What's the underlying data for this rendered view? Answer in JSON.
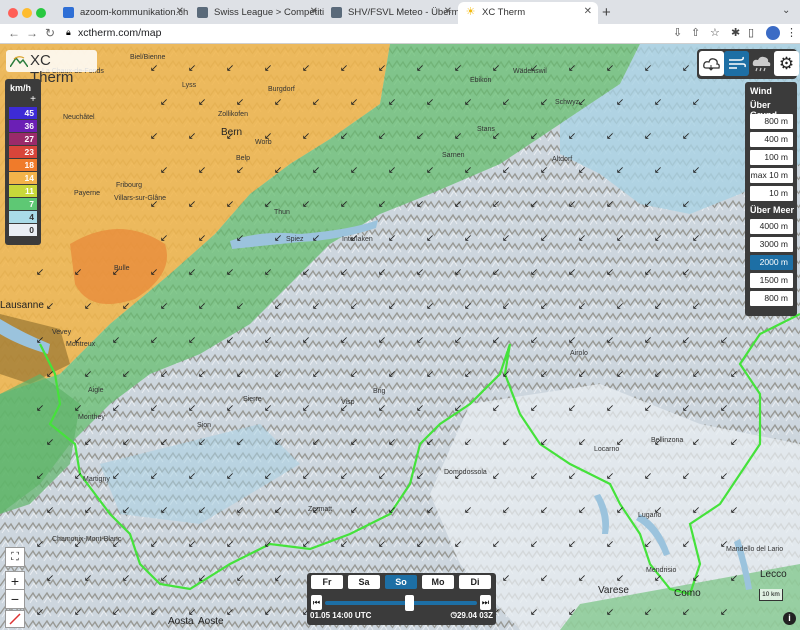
{
  "browser": {
    "tabs": [
      {
        "label": "azoom-kommunikation.ch – Ka",
        "fav_color": "#2f6fd6"
      },
      {
        "label": "Swiss League > Competition N",
        "fav_color": "#5a6a7a"
      },
      {
        "label": "SHV/FSVL Meteo - Übermorge",
        "fav_color": "#5a6a7a"
      },
      {
        "label": "XC Therm",
        "fav_color": "#f2b90f"
      }
    ],
    "url": "xctherm.com/map"
  },
  "app": {
    "logo_text": "XC Therm"
  },
  "legend": {
    "unit": "km/h",
    "rows": [
      {
        "label": "45",
        "color": "#3d2bd6"
      },
      {
        "label": "36",
        "color": "#6b1fb5"
      },
      {
        "label": "27",
        "color": "#9a2a6a"
      },
      {
        "label": "23",
        "color": "#d8453a"
      },
      {
        "label": "18",
        "color": "#f07b2a"
      },
      {
        "label": "14",
        "color": "#f2b34a"
      },
      {
        "label": "11",
        "color": "#c8d83a"
      },
      {
        "label": "7",
        "color": "#5ec874"
      },
      {
        "label": "4",
        "color": "#a9dbe8"
      },
      {
        "label": "0",
        "color": "#e9eef4"
      }
    ]
  },
  "wind_panel": {
    "title": "Wind",
    "above_ground_title": "Über Grund",
    "above_ground": [
      "800 m",
      "400 m",
      "100 m",
      "max 10 m",
      "10 m"
    ],
    "above_sea_title": "Über Meer",
    "above_sea": [
      "4000 m",
      "3000 m",
      "2000 m",
      "1500 m",
      "800 m"
    ],
    "selected": "2000 m"
  },
  "timeline": {
    "days": [
      "Fr",
      "Sa",
      "So",
      "Mo",
      "Di"
    ],
    "selected_day": "So",
    "start_label": "01.05 14:00 UTC",
    "end_label": "29.04 03Z",
    "slider_fraction": 0.55
  },
  "map": {
    "scale_label": "10 km",
    "cities": [
      {
        "name": "Bern",
        "big": true
      },
      {
        "name": "Interlaken"
      },
      {
        "name": "Burgdorf"
      },
      {
        "name": "Zollikofen"
      },
      {
        "name": "Worb"
      },
      {
        "name": "Belp"
      },
      {
        "name": "Thun"
      },
      {
        "name": "Spiez"
      },
      {
        "name": "Fribourg"
      },
      {
        "name": "Payerne"
      },
      {
        "name": "Villars-sur-Glâne"
      },
      {
        "name": "Bulle"
      },
      {
        "name": "Vevey"
      },
      {
        "name": "Montreux"
      },
      {
        "name": "Aigle"
      },
      {
        "name": "Monthey"
      },
      {
        "name": "Martigny"
      },
      {
        "name": "Sion"
      },
      {
        "name": "Sierre"
      },
      {
        "name": "Visp"
      },
      {
        "name": "Brig"
      },
      {
        "name": "Zermatt"
      },
      {
        "name": "Chamonix-Mont-Blanc"
      },
      {
        "name": "Domodossola"
      },
      {
        "name": "Locarno"
      },
      {
        "name": "Bellinzona"
      },
      {
        "name": "Lugano"
      },
      {
        "name": "Mendrisio"
      },
      {
        "name": "Varese",
        "big": true
      },
      {
        "name": "Como",
        "big": true
      },
      {
        "name": "Lecco",
        "big": true
      },
      {
        "name": "Aosta",
        "big": true
      },
      {
        "name": "Aoste",
        "big": true
      },
      {
        "name": "Altdorf"
      },
      {
        "name": "Stans"
      },
      {
        "name": "Sarnen"
      },
      {
        "name": "Neuchâtel"
      },
      {
        "name": "Biel/Bienne"
      },
      {
        "name": "Lyss"
      },
      {
        "name": "Mandello del Lario"
      },
      {
        "name": "Airolo"
      },
      {
        "name": "Ebikon"
      },
      {
        "name": "Wädenswil"
      },
      {
        "name": "Schwyz"
      },
      {
        "name": "La Chaux-de-Fonds"
      },
      {
        "name": "Lausanne",
        "big": true
      }
    ]
  }
}
